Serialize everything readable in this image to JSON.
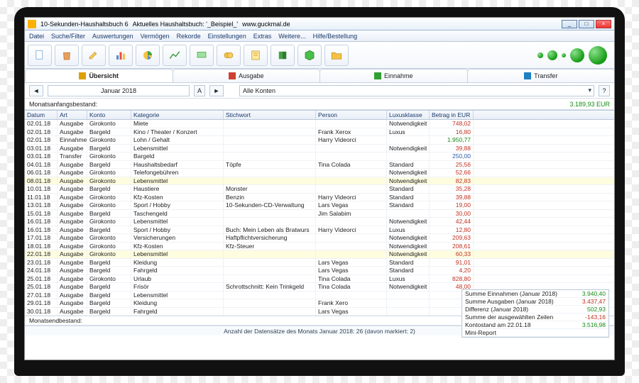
{
  "window": {
    "title1": "10-Sekunden-Haushaltsbuch 6",
    "title2": "Aktuelles Haushaltsbuch: '_Beispiel_'",
    "title3": "www.guckmal.de"
  },
  "menu": [
    "Datei",
    "Suche/Filter",
    "Auswertungen",
    "Vermögen",
    "Rekorde",
    "Einstellungen",
    "Extras",
    "Weitere...",
    "Hilfe/Bestellung"
  ],
  "tabs": [
    {
      "label": "Übersicht",
      "icon": "#e0a000"
    },
    {
      "label": "Ausgabe",
      "icon": "#d04030"
    },
    {
      "label": "Einnahme",
      "icon": "#30a030"
    },
    {
      "label": "Transfer",
      "icon": "#2080c0"
    }
  ],
  "filter": {
    "month": "Januar 2018",
    "account": "Alle Konten"
  },
  "start": {
    "label": "Monatsanfangsbestand:",
    "value": "3.189,93 EUR"
  },
  "end": {
    "label": "Monatsendbestand:"
  },
  "headers": [
    "Datum",
    "Art",
    "Konto",
    "Kategorie",
    "Stichwort",
    "Person",
    "Luxusklasse",
    "Betrag in EUR"
  ],
  "rows": [
    {
      "d": "02.01.18",
      "a": "Ausgabe",
      "k": "Girokonto",
      "c": "Miete",
      "s": "",
      "p": "",
      "l": "Notwendigkeit",
      "b": "748,02",
      "cls": "red"
    },
    {
      "d": "02.01.18",
      "a": "Ausgabe",
      "k": "Bargeld",
      "c": "Kino / Theater / Konzert",
      "s": "",
      "p": "Frank Xerox",
      "l": "Luxus",
      "b": "16,80",
      "cls": "red"
    },
    {
      "d": "02.01.18",
      "a": "Einnahme",
      "k": "Girokonto",
      "c": "Lohn / Gehalt",
      "s": "",
      "p": "Harry Videorci",
      "l": "",
      "b": "1.950,77",
      "cls": "green"
    },
    {
      "d": "03.01.18",
      "a": "Ausgabe",
      "k": "Bargeld",
      "c": "Lebensmittel",
      "s": "",
      "p": "",
      "l": "Notwendigkeit",
      "b": "39,88",
      "cls": "red"
    },
    {
      "d": "03.01.18",
      "a": "Transfer",
      "k": "Girokonto",
      "c": "Bargeld",
      "s": "",
      "p": "",
      "l": "",
      "b": "250,00",
      "cls": "blue"
    },
    {
      "d": "04.01.18",
      "a": "Ausgabe",
      "k": "Bargeld",
      "c": "Haushaltsbedarf",
      "s": "Töpfe",
      "p": "Tina Colada",
      "l": "Standard",
      "b": "25,56",
      "cls": "red"
    },
    {
      "d": "06.01.18",
      "a": "Ausgabe",
      "k": "Girokonto",
      "c": "Telefongebühren",
      "s": "",
      "p": "",
      "l": "Notwendigkeit",
      "b": "52,66",
      "cls": "red"
    },
    {
      "d": "08.01.18",
      "a": "Ausgabe",
      "k": "Girokonto",
      "c": "Lebensmittel",
      "s": "",
      "p": "",
      "l": "Notwendigkeit",
      "b": "82,83",
      "cls": "red",
      "hl": true
    },
    {
      "d": "10.01.18",
      "a": "Ausgabe",
      "k": "Bargeld",
      "c": "Haustiere",
      "s": "Monster",
      "p": "",
      "l": "Standard",
      "b": "35,28",
      "cls": "red"
    },
    {
      "d": "11.01.18",
      "a": "Ausgabe",
      "k": "Girokonto",
      "c": "Kfz-Kosten",
      "s": "Benzin",
      "p": "Harry Videorci",
      "l": "Standard",
      "b": "39,88",
      "cls": "red"
    },
    {
      "d": "13.01.18",
      "a": "Ausgabe",
      "k": "Girokonto",
      "c": "Sport / Hobby",
      "s": "10-Sekunden-CD-Verwaltung",
      "p": "Lars Vegas",
      "l": "Standard",
      "b": "19,00",
      "cls": "red"
    },
    {
      "d": "15.01.18",
      "a": "Ausgabe",
      "k": "Bargeld",
      "c": "Taschengeld",
      "s": "",
      "p": "Jim Salabim",
      "l": "",
      "b": "30,00",
      "cls": "red"
    },
    {
      "d": "16.01.18",
      "a": "Ausgabe",
      "k": "Girokonto",
      "c": "Lebensmittel",
      "s": "",
      "p": "",
      "l": "Notwendigkeit",
      "b": "42,44",
      "cls": "red"
    },
    {
      "d": "16.01.18",
      "a": "Ausgabe",
      "k": "Bargeld",
      "c": "Sport / Hobby",
      "s": "Buch: Mein Leben als Bratwurs",
      "p": "Harry Videorci",
      "l": "Luxus",
      "b": "12,80",
      "cls": "red"
    },
    {
      "d": "17.01.18",
      "a": "Ausgabe",
      "k": "Girokonto",
      "c": "Versicherungen",
      "s": "Haftpflichtversicherung",
      "p": "",
      "l": "Notwendigkeit",
      "b": "209,63",
      "cls": "red"
    },
    {
      "d": "18.01.18",
      "a": "Ausgabe",
      "k": "Girokonto",
      "c": "Kfz-Kosten",
      "s": "Kfz-Steuer",
      "p": "",
      "l": "Notwendigkeit",
      "b": "208,61",
      "cls": "red"
    },
    {
      "d": "22.01.18",
      "a": "Ausgabe",
      "k": "Girokonto",
      "c": "Lebensmittel",
      "s": "",
      "p": "",
      "l": "Notwendigkeit",
      "b": "60,33",
      "cls": "red",
      "hl": true
    },
    {
      "d": "23.01.18",
      "a": "Ausgabe",
      "k": "Bargeld",
      "c": "Kleidung",
      "s": "",
      "p": "Lars Vegas",
      "l": "Standard",
      "b": "91,01",
      "cls": "red"
    },
    {
      "d": "24.01.18",
      "a": "Ausgabe",
      "k": "Bargeld",
      "c": "Fahrgeld",
      "s": "",
      "p": "Lars Vegas",
      "l": "Standard",
      "b": "4,20",
      "cls": "red"
    },
    {
      "d": "25.01.18",
      "a": "Ausgabe",
      "k": "Girokonto",
      "c": "Urlaub",
      "s": "",
      "p": "Tina Colada",
      "l": "Luxus",
      "b": "828,80",
      "cls": "red"
    },
    {
      "d": "25.01.18",
      "a": "Ausgabe",
      "k": "Bargeld",
      "c": "Frisör",
      "s": "Schrottschnitt: Kein Trinkgeld",
      "p": "Tina Colada",
      "l": "Notwendigkeit",
      "b": "48,00",
      "cls": "red"
    },
    {
      "d": "27.01.18",
      "a": "Ausgabe",
      "k": "Bargeld",
      "c": "Lebensmittel",
      "s": "",
      "p": "",
      "l": "",
      "b": "",
      "cls": ""
    },
    {
      "d": "29.01.18",
      "a": "Ausgabe",
      "k": "Bargeld",
      "c": "Kleidung",
      "s": "",
      "p": "Frank Xero",
      "l": "",
      "b": "",
      "cls": ""
    },
    {
      "d": "30.01.18",
      "a": "Ausgabe",
      "k": "Bargeld",
      "c": "Fahrgeld",
      "s": "",
      "p": "Lars Vegas",
      "l": "",
      "b": "",
      "cls": ""
    }
  ],
  "summary": [
    {
      "label": "Summe Einnahmen (Januar 2018)",
      "value": "3.940,40",
      "cls": "green"
    },
    {
      "label": "Summe Ausgaben (Januar 2018)",
      "value": "3.437,47",
      "cls": "red"
    },
    {
      "label": "Differenz (Januar 2018)",
      "value": "502,93",
      "cls": "green"
    },
    {
      "label": "Summe der ausgewählten Zeilen",
      "value": "-143,16",
      "cls": "red"
    },
    {
      "label": "Kontostand am 22.01.18",
      "value": "3.516,98",
      "cls": "green"
    },
    {
      "label": "Mini-Report",
      "value": "",
      "cls": ""
    }
  ],
  "status": "Anzahl der Datensätze des Monats Januar 2018: 26 (davon markiert: 2)"
}
